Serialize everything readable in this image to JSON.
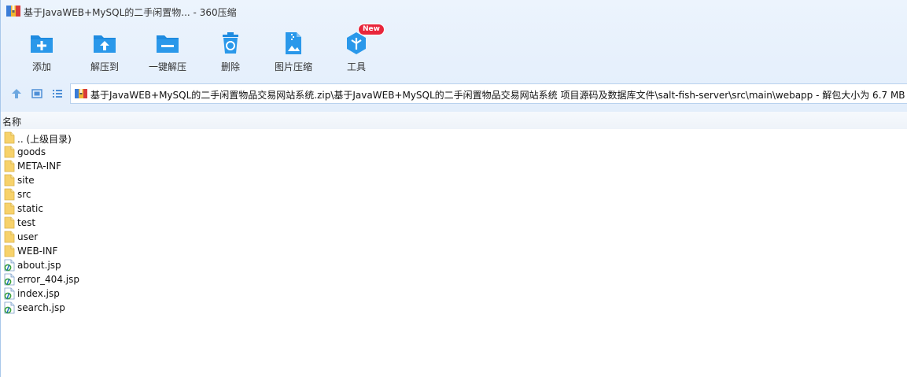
{
  "window": {
    "title": "基于JavaWEB+MySQL的二手闲置物... - 360压缩"
  },
  "toolbar": {
    "items": [
      {
        "label": "添加",
        "icon": "add-file-icon"
      },
      {
        "label": "解压到",
        "icon": "extract-to-icon"
      },
      {
        "label": "一键解压",
        "icon": "one-click-extract-icon"
      },
      {
        "label": "删除",
        "icon": "delete-icon"
      },
      {
        "label": "图片压缩",
        "icon": "image-compress-icon"
      },
      {
        "label": "工具",
        "icon": "tools-icon"
      }
    ],
    "badge": "New"
  },
  "nav": {
    "up_icon": "up-arrow-icon",
    "view_icon": "thumbnail-view-icon",
    "list_icon": "list-view-icon"
  },
  "address": {
    "path": "基于JavaWEB+MySQL的二手闲置物品交易网站系统.zip\\基于JavaWEB+MySQL的二手闲置物品交易网站系统 项目源码及数据库文件\\salt-fish-server\\src\\main\\webapp - 解包大小为 6.7 MB"
  },
  "columns": {
    "name": "名称"
  },
  "files": [
    {
      "name": ".. (上级目录)",
      "type": "folder"
    },
    {
      "name": "goods",
      "type": "folder"
    },
    {
      "name": "META-INF",
      "type": "folder"
    },
    {
      "name": "site",
      "type": "folder"
    },
    {
      "name": "src",
      "type": "folder"
    },
    {
      "name": "static",
      "type": "folder"
    },
    {
      "name": "test",
      "type": "folder"
    },
    {
      "name": "user",
      "type": "folder"
    },
    {
      "name": "WEB-INF",
      "type": "folder"
    },
    {
      "name": "about.jsp",
      "type": "jsp"
    },
    {
      "name": "error_404.jsp",
      "type": "jsp"
    },
    {
      "name": "index.jsp",
      "type": "jsp"
    },
    {
      "name": "search.jsp",
      "type": "jsp"
    }
  ],
  "colors": {
    "accent": "#1e8be0",
    "folder": "#f7d26b",
    "badge": "#e8263b"
  }
}
